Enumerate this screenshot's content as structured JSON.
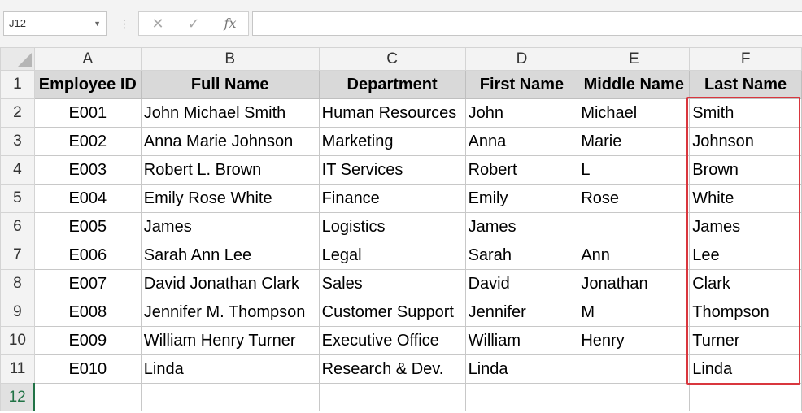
{
  "name_box": {
    "value": "J12"
  },
  "formula_bar": {
    "cancel_symbol": "✕",
    "enter_symbol": "✓",
    "fx_symbol": "fx",
    "value": ""
  },
  "columns": [
    "A",
    "B",
    "C",
    "D",
    "E",
    "F"
  ],
  "rows": [
    "1",
    "2",
    "3",
    "4",
    "5",
    "6",
    "7",
    "8",
    "9",
    "10",
    "11",
    "12"
  ],
  "active_row": "12",
  "header": [
    "Employee ID",
    "Full Name",
    "Department",
    "First Name",
    "Middle Name",
    "Last Name"
  ],
  "data": [
    [
      "E001",
      "John Michael Smith",
      "Human Resources",
      "John",
      "Michael",
      "Smith"
    ],
    [
      "E002",
      "Anna Marie Johnson",
      "Marketing",
      "Anna",
      "Marie",
      "Johnson"
    ],
    [
      "E003",
      "Robert L. Brown",
      "IT Services",
      "Robert",
      "L",
      "Brown"
    ],
    [
      "E004",
      "Emily Rose White",
      "Finance",
      "Emily",
      "Rose",
      "White"
    ],
    [
      "E005",
      "James",
      "Logistics",
      "James",
      "",
      "James"
    ],
    [
      "E006",
      "Sarah Ann Lee",
      "Legal",
      "Sarah",
      "Ann",
      "Lee"
    ],
    [
      "E007",
      "David Jonathan Clark",
      "Sales",
      "David",
      "Jonathan",
      "Clark"
    ],
    [
      "E008",
      "Jennifer M. Thompson",
      "Customer Support",
      "Jennifer",
      "M",
      "Thompson"
    ],
    [
      "E009",
      "William Henry Turner",
      "Executive Office",
      "William",
      "Henry",
      "Turner"
    ],
    [
      "E010",
      "Linda",
      "Research & Dev.",
      "Linda",
      "",
      "Linda"
    ]
  ],
  "colors": {
    "highlight_border": "#d9363e",
    "header_fill": "#d9d9d9",
    "active_row_accent": "#217346"
  }
}
